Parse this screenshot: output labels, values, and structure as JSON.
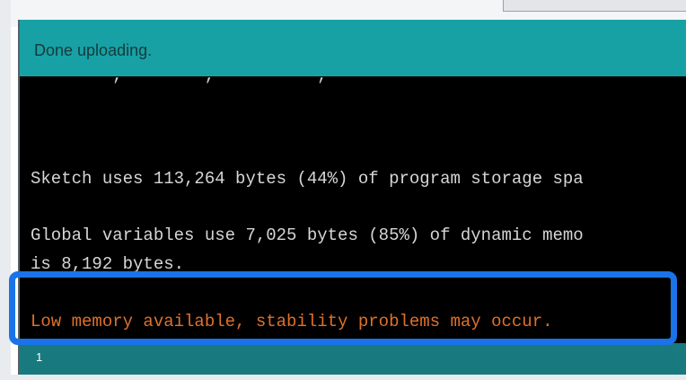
{
  "status_bar": {
    "message": "Done uploading."
  },
  "console": {
    "lines": [
      "Sketch uses 113,264 bytes (44%) of program storage spa",
      "Global variables use 7,025 bytes (85%) of dynamic memo",
      "is 8,192 bytes.",
      "Low memory available, stability problems may occur."
    ]
  },
  "footer": {
    "line_number": "1"
  },
  "colors": {
    "status_bar": "#17a1a5",
    "console_bg": "#000000",
    "warning_text": "#e0702a",
    "highlight_border": "#1a73e8"
  }
}
